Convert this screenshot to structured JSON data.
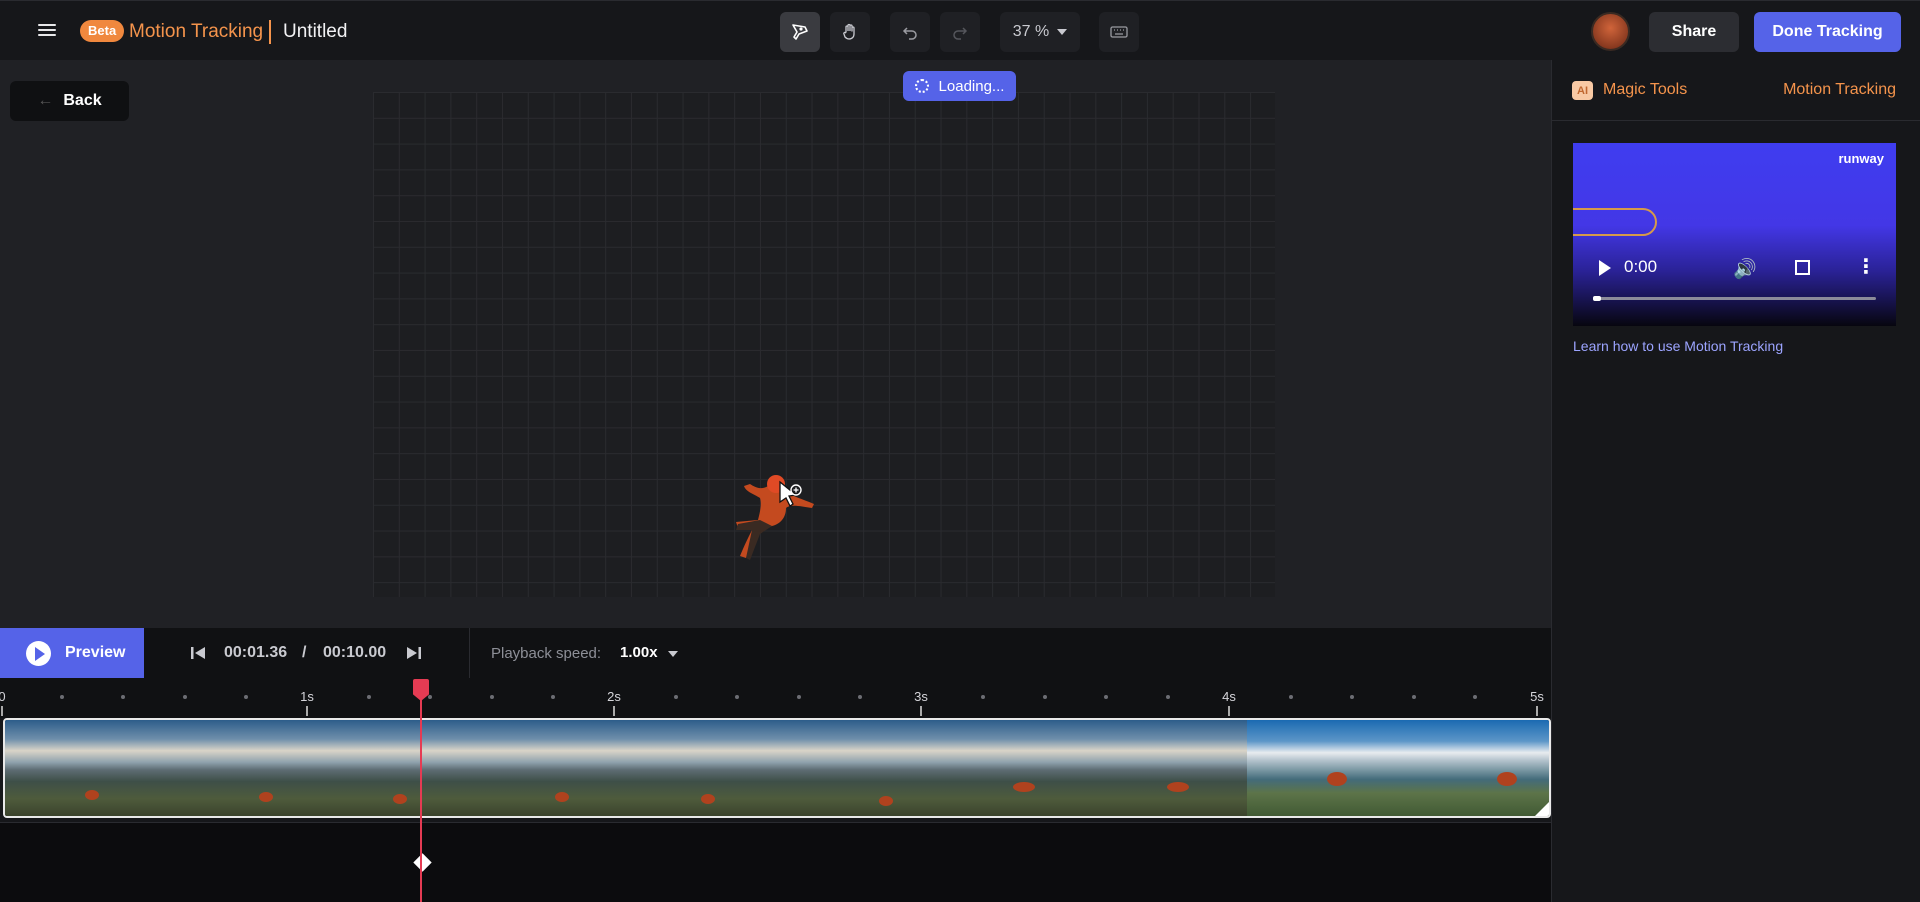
{
  "header": {
    "beta_label": "Beta",
    "app_title": "Motion Tracking",
    "doc_title": "Untitled",
    "zoom": "37 %",
    "share_label": "Share",
    "done_label": "Done Tracking"
  },
  "workspace": {
    "back_label": "Back",
    "loading_label": "Loading..."
  },
  "sidepanel": {
    "ai_badge": "AI",
    "magic_tools": "Magic Tools",
    "motion_tracking": "Motion Tracking",
    "video_brand": "runway",
    "video_time": "0:00",
    "learn_link": "Learn how to use Motion Tracking"
  },
  "controls": {
    "preview_label": "Preview",
    "current_time": "00:01.36",
    "separator": "/",
    "total_time": "00:10.00",
    "speed_label": "Playback speed:",
    "speed_value": "1.00x"
  },
  "ruler": {
    "labels": [
      "0",
      "1s",
      "2s",
      "3s",
      "4s",
      "5s"
    ]
  },
  "colors": {
    "accent": "#5563e8",
    "brand_orange": "#f5944c",
    "playhead": "#e53b53"
  },
  "icons": {
    "menu": "menu-icon",
    "pen_tool": "tracking-pen-icon",
    "hand_tool": "hand-icon",
    "undo": "undo-icon",
    "redo": "redo-icon",
    "keyboard": "keyboard-icon"
  }
}
